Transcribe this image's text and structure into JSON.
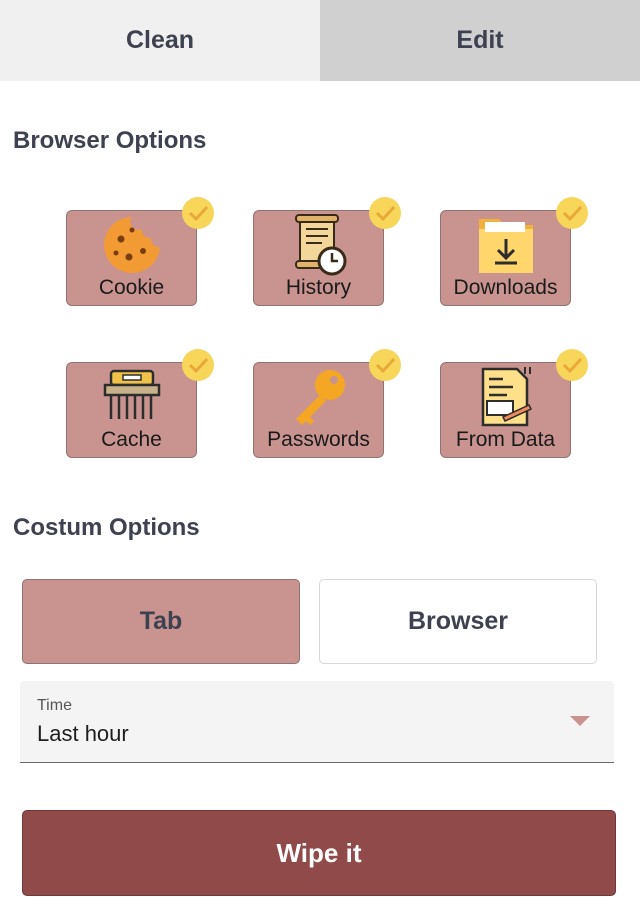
{
  "tabs": {
    "clean": "Clean",
    "edit": "Edit",
    "active": "clean"
  },
  "browser_options": {
    "title": "Browser Options",
    "items": [
      {
        "label": "Cookie",
        "icon": "cookie-icon",
        "checked": true
      },
      {
        "label": "History",
        "icon": "history-scroll-icon",
        "checked": true
      },
      {
        "label": "Downloads",
        "icon": "downloads-folder-icon",
        "checked": true
      },
      {
        "label": "Cache",
        "icon": "cache-brush-icon",
        "checked": true
      },
      {
        "label": "Passwords",
        "icon": "key-icon",
        "checked": true
      },
      {
        "label": "From Data",
        "icon": "form-data-icon",
        "checked": true
      }
    ]
  },
  "custom_options": {
    "title": "Costum Options",
    "scope": {
      "tab": "Tab",
      "browser": "Browser",
      "selected": "Tab"
    },
    "time": {
      "label": "Time",
      "value": "Last hour"
    }
  },
  "action": {
    "wipe_label": "Wipe it"
  },
  "colors": {
    "accent": "#c99490",
    "button": "#8f4a49",
    "check": "#f7d65a"
  }
}
